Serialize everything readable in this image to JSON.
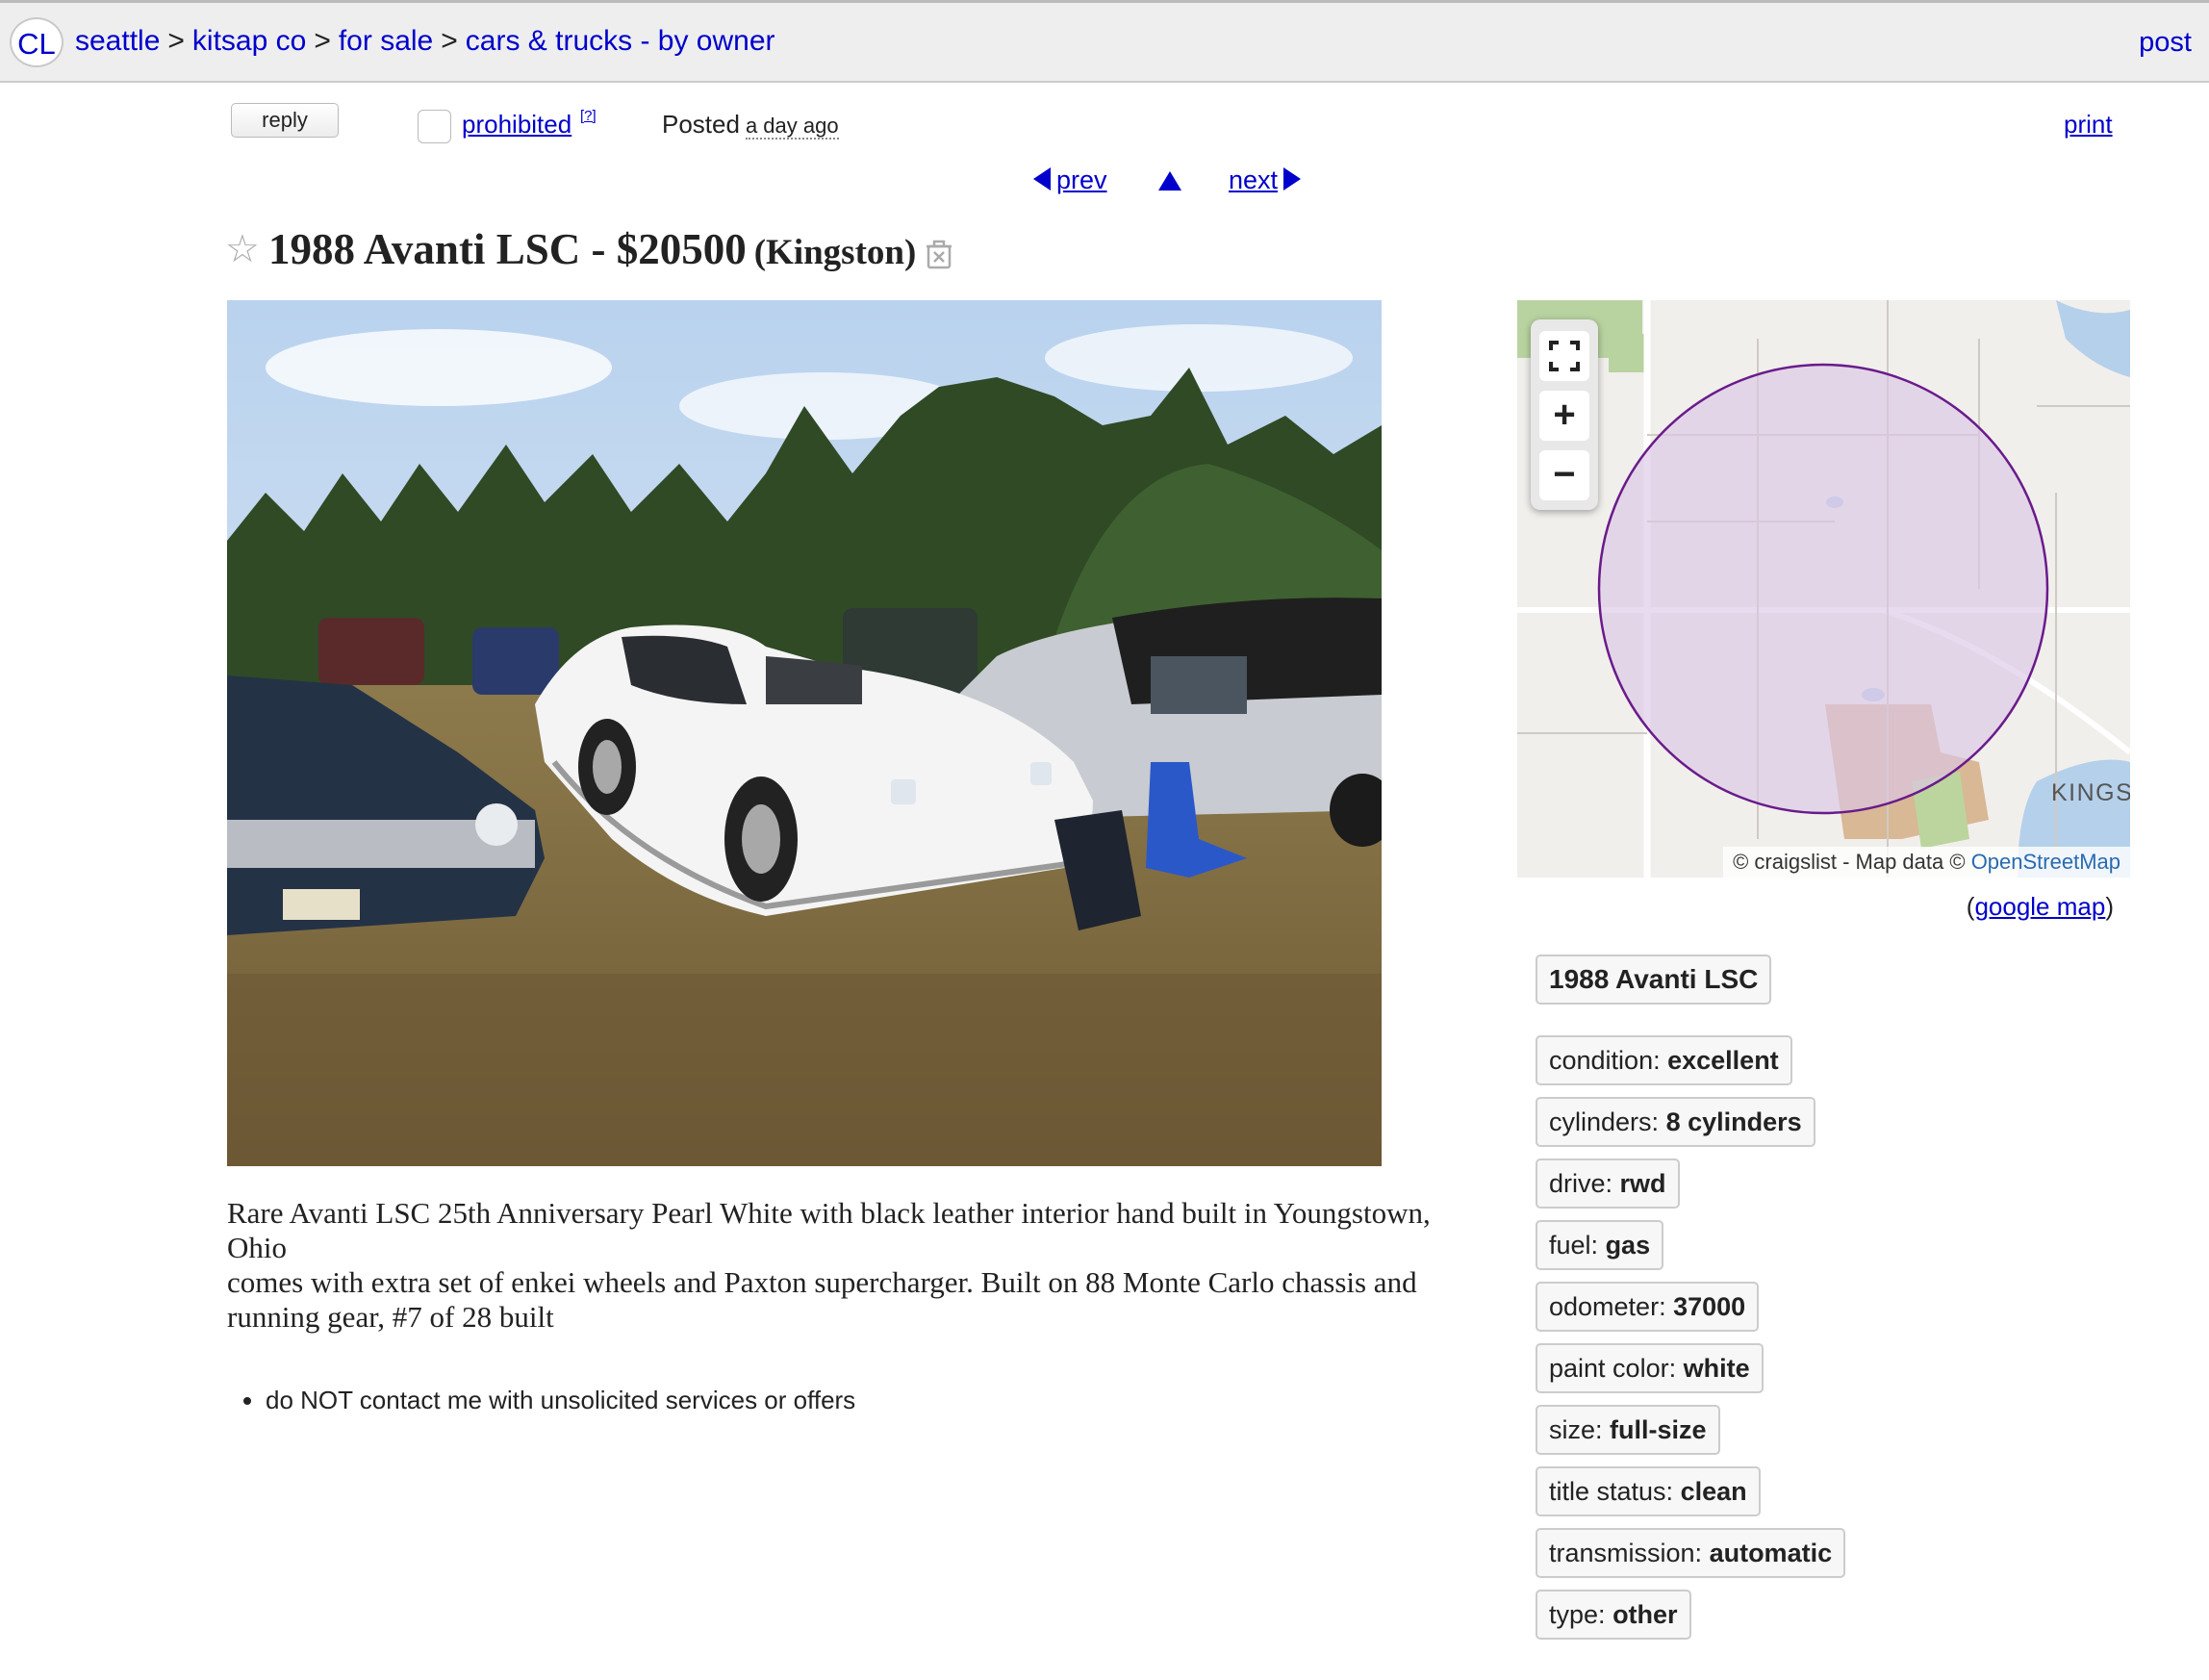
{
  "header": {
    "logo": "CL",
    "breadcrumbs": [
      "seattle",
      "kitsap co",
      "for sale",
      "cars & trucks - by owner"
    ],
    "separator": ">",
    "post_label": "post"
  },
  "actions": {
    "reply_label": "reply",
    "prohibited_label": "prohibited",
    "help_label": "[?]",
    "posted_label": "Posted",
    "posted_ago": "a day ago",
    "print_label": "print"
  },
  "nav": {
    "prev_label": "prev",
    "next_label": "next"
  },
  "title": {
    "main": "1988 Avanti LSC - $20500",
    "hood": "(Kingston)"
  },
  "map": {
    "attribution_prefix": "© craigslist - Map data ©",
    "attribution_link": "OpenStreetMap",
    "place_label": "KINGS",
    "zoom_in": "+",
    "zoom_out": "−",
    "google_map_open": "(",
    "google_map_label": "google map",
    "google_map_close": ")"
  },
  "attributes": {
    "title": "1988 Avanti LSC",
    "items": [
      {
        "label": "condition:",
        "value": "excellent"
      },
      {
        "label": "cylinders:",
        "value": "8 cylinders"
      },
      {
        "label": "drive:",
        "value": "rwd"
      },
      {
        "label": "fuel:",
        "value": "gas"
      },
      {
        "label": "odometer:",
        "value": "37000"
      },
      {
        "label": "paint color:",
        "value": "white"
      },
      {
        "label": "size:",
        "value": "full-size"
      },
      {
        "label": "title status:",
        "value": "clean"
      },
      {
        "label": "transmission:",
        "value": "automatic"
      },
      {
        "label": "type:",
        "value": "other"
      }
    ]
  },
  "body": {
    "line1": "Rare Avanti LSC 25th Anniversary Pearl White with black leather interior hand built in Youngstown, Ohio",
    "line2": "comes with extra set of enkei wheels and Paxton supercharger. Built on 88 Monte Carlo chassis and running gear, #7 of 28 built"
  },
  "notices": [
    "do NOT contact me with unsolicited services or offers"
  ],
  "colors": {
    "link": "#0000cc",
    "map_circle_stroke": "#6a1b8a",
    "map_circle_fill": "#dcc6e6"
  }
}
